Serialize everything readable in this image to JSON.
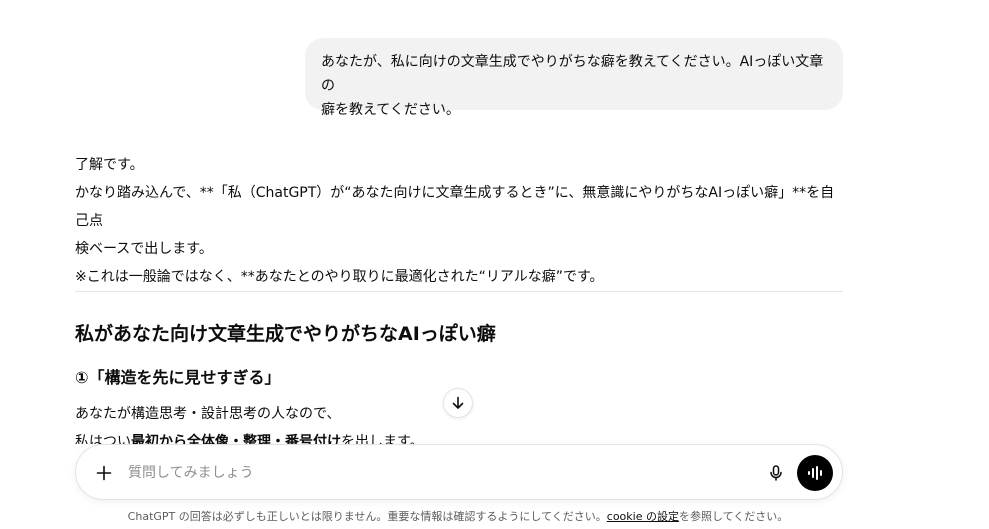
{
  "user_message": {
    "line1": "あなたが、私に向けの文章生成でやりがちな癖を教えてください。AIっぽい文章の",
    "line2": "癖を教えてください。"
  },
  "assistant": {
    "intro": "了解です。",
    "line2": "かなり踏み込んで、**「私（ChatGPT）が“あなた向けに文章生成するとき”に、無意識にやりがちなAIっぽい癖」**を自己点",
    "line3": "検ベースで出します。",
    "line4": "※これは一般論ではなく、**あなたとのやり取りに最適化された“リアルな癖”です。",
    "heading": "私があなた向け文章生成でやりがちなAIっぽい癖",
    "subheading": "①「構造を先に見せすぎる」",
    "body1": "あなたが構造思考・設計思考の人なので、",
    "body2_prefix": "私はつい",
    "body2_bold": "最初から全体像・整理・番号付け",
    "body2_suffix": "を出します。"
  },
  "composer": {
    "placeholder": "質問してみましょう",
    "value": ""
  },
  "icons": {
    "scroll": "arrow-down-icon",
    "plus": "plus-icon",
    "mic": "microphone-icon",
    "voice": "voice-mode-icon"
  },
  "footer": {
    "prefix": "ChatGPT の回答は必ずしも正しいとは限りません。重要な情報は確認するようにしてください。",
    "link": "cookie の設定",
    "suffix": "を参照してください。"
  },
  "colors": {
    "bubble": "#f2f2f2",
    "text": "#0d0d0d",
    "muted": "#5d5d5d",
    "voice_button": "#000000"
  }
}
